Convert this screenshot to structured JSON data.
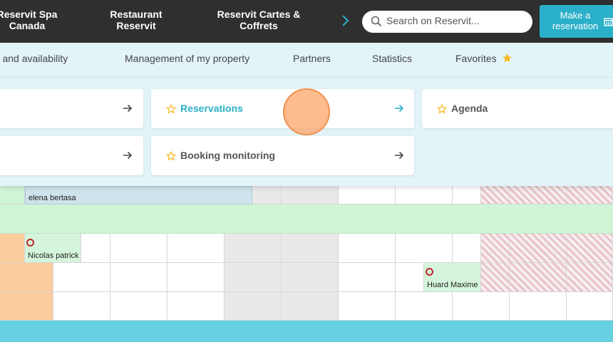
{
  "topnav": {
    "items": [
      "Reservit Spa\nCanada",
      "Restaurant\nReservit",
      "Reservit Cartes &\nCoffrets"
    ]
  },
  "search": {
    "placeholder": "Search on Reservit..."
  },
  "make_reservation": {
    "label": "Make a\nreservation"
  },
  "secnav": {
    "items": [
      "Rates and availability",
      "Management of my property",
      "Partners",
      "Statistics",
      "Favorites"
    ]
  },
  "menu": {
    "reservations": "Reservations",
    "booking_monitoring": "Booking monitoring",
    "agenda": "Agenda"
  },
  "calendar": {
    "reservations": [
      {
        "name": "elena bertasa"
      },
      {
        "name": "Nicolas patrick"
      },
      {
        "name": "Huard Maxime"
      }
    ]
  },
  "colors": {
    "topbar": "#2f2f2f",
    "accent": "#2ab0c8",
    "favorite_star": "#f5b81d",
    "subnav_bg": "#e3f4f9"
  }
}
